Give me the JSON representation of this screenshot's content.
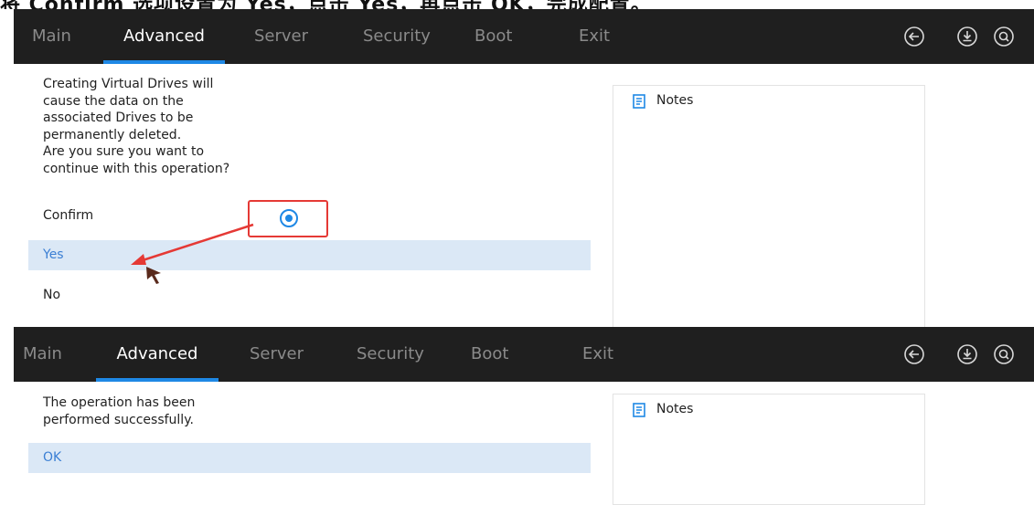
{
  "top_caption": "将 Confirm 选项设置为 Yes，点击 Yes，再点击 OK，完成配置。",
  "nav": {
    "tabs": [
      "Main",
      "Advanced",
      "Server",
      "Security",
      "Boot",
      "Exit"
    ],
    "active_tab": "Advanced",
    "icons": [
      "back-circle-icon",
      "save-download-icon",
      "search-icon"
    ],
    "accent_color": "#1e88e5",
    "bar_color": "#1f1f1f"
  },
  "dialog1": {
    "message_lines": [
      "Creating Virtual Drives will",
      "cause the data on the",
      "associated Drives to be",
      "permanently deleted.",
      "Are you sure you want to",
      "continue with this operation?"
    ],
    "confirm_label": "Confirm",
    "confirm_selected": true,
    "options": [
      "Yes",
      "No"
    ],
    "highlighted_option": "Yes"
  },
  "dialog2": {
    "message_lines": [
      "The operation has been",
      "performed successfully."
    ],
    "options": [
      "OK"
    ],
    "highlighted_option": "OK"
  },
  "notes": {
    "title": "Notes"
  },
  "annotations": {
    "highlight_color": "#e53935"
  }
}
